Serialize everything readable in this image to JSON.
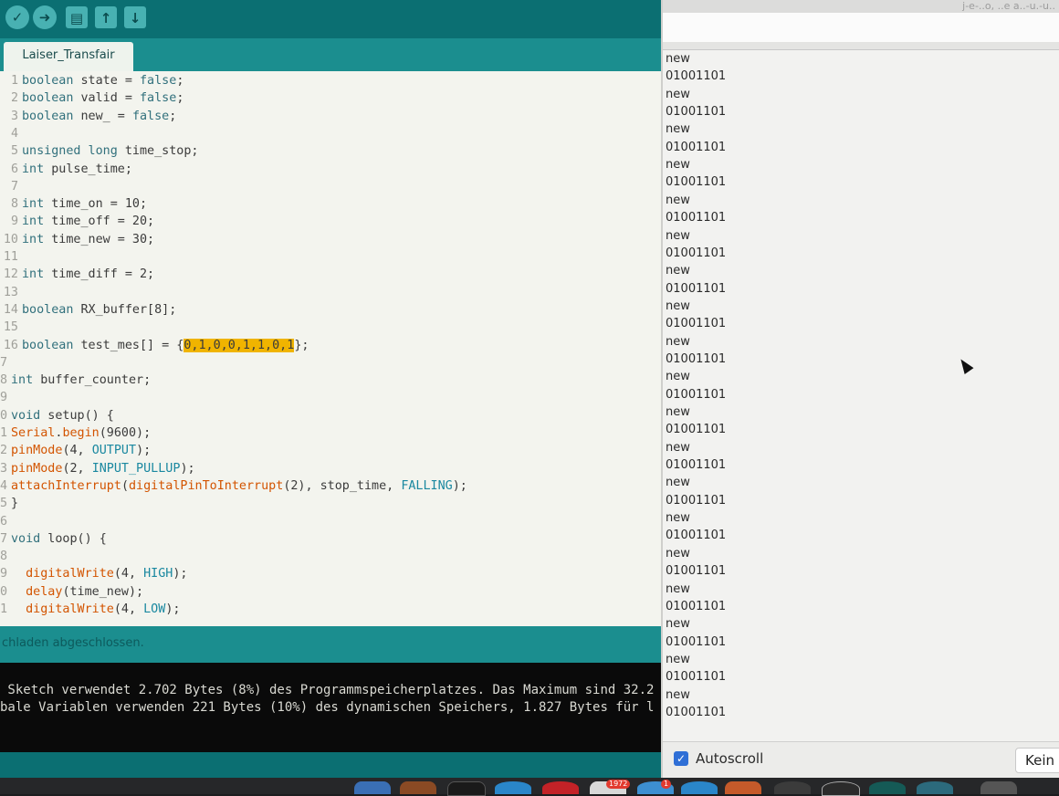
{
  "ide": {
    "tab_name": "Laiser_Transfair",
    "code_lines": [
      {
        "n": "1",
        "parts": [
          {
            "t": "boolean",
            "c": "ty"
          },
          {
            "t": " state = "
          },
          {
            "t": "false",
            "c": "kw"
          },
          {
            "t": ";"
          }
        ]
      },
      {
        "n": "2",
        "parts": [
          {
            "t": "boolean",
            "c": "ty"
          },
          {
            "t": " valid = "
          },
          {
            "t": "false",
            "c": "kw"
          },
          {
            "t": ";"
          }
        ]
      },
      {
        "n": "3",
        "parts": [
          {
            "t": "boolean",
            "c": "ty"
          },
          {
            "t": " new_ = "
          },
          {
            "t": "false",
            "c": "kw"
          },
          {
            "t": ";"
          }
        ]
      },
      {
        "n": "4",
        "parts": []
      },
      {
        "n": "5",
        "parts": [
          {
            "t": "unsigned long",
            "c": "ty"
          },
          {
            "t": " time_stop;"
          }
        ]
      },
      {
        "n": "6",
        "parts": [
          {
            "t": "int",
            "c": "ty"
          },
          {
            "t": " pulse_time;"
          }
        ]
      },
      {
        "n": "7",
        "parts": []
      },
      {
        "n": "8",
        "parts": [
          {
            "t": "int",
            "c": "ty"
          },
          {
            "t": " time_on = 10;"
          }
        ]
      },
      {
        "n": "9",
        "parts": [
          {
            "t": "int",
            "c": "ty"
          },
          {
            "t": " time_off = 20;"
          }
        ]
      },
      {
        "n": "10",
        "parts": [
          {
            "t": "int",
            "c": "ty"
          },
          {
            "t": " time_new = 30;"
          }
        ]
      },
      {
        "n": "11",
        "parts": []
      },
      {
        "n": "12",
        "parts": [
          {
            "t": "int",
            "c": "ty"
          },
          {
            "t": " time_diff = 2;"
          }
        ]
      },
      {
        "n": "13",
        "parts": []
      },
      {
        "n": "14",
        "parts": [
          {
            "t": "boolean",
            "c": "ty"
          },
          {
            "t": " RX_buffer[8];"
          }
        ]
      },
      {
        "n": "15",
        "parts": []
      },
      {
        "n": "16",
        "parts": [
          {
            "t": "boolean",
            "c": "ty"
          },
          {
            "t": " test_mes[] = {"
          },
          {
            "t": "0,1,0,0,1,1,0,1",
            "c": "hl"
          },
          {
            "t": "};"
          }
        ]
      },
      {
        "n": "7",
        "cut": true,
        "parts": []
      },
      {
        "n": "8",
        "cut": true,
        "parts": [
          {
            "t": "int",
            "c": "ty"
          },
          {
            "t": " buffer_counter;"
          }
        ]
      },
      {
        "n": "9",
        "cut": true,
        "parts": []
      },
      {
        "n": "0",
        "cut": true,
        "parts": [
          {
            "t": "void",
            "c": "ty"
          },
          {
            "t": " setup() {"
          }
        ]
      },
      {
        "n": "1",
        "cut": true,
        "parts": [
          {
            "t": "Serial",
            "c": "fn"
          },
          {
            "t": "."
          },
          {
            "t": "begin",
            "c": "fn"
          },
          {
            "t": "(9600);"
          }
        ]
      },
      {
        "n": "2",
        "cut": true,
        "parts": [
          {
            "t": "pinMode",
            "c": "fn"
          },
          {
            "t": "(4, "
          },
          {
            "t": "OUTPUT",
            "c": "cn"
          },
          {
            "t": ");"
          }
        ]
      },
      {
        "n": "3",
        "cut": true,
        "parts": [
          {
            "t": "pinMode",
            "c": "fn"
          },
          {
            "t": "(2, "
          },
          {
            "t": "INPUT_PULLUP",
            "c": "cn"
          },
          {
            "t": ");"
          }
        ]
      },
      {
        "n": "4",
        "cut": true,
        "parts": [
          {
            "t": "attachInterrupt",
            "c": "fn"
          },
          {
            "t": "("
          },
          {
            "t": "digitalPinToInterrupt",
            "c": "fn"
          },
          {
            "t": "(2), stop_time, "
          },
          {
            "t": "FALLING",
            "c": "cn"
          },
          {
            "t": ");"
          }
        ]
      },
      {
        "n": "5",
        "cut": true,
        "parts": [
          {
            "t": "}"
          }
        ]
      },
      {
        "n": "6",
        "cut": true,
        "parts": []
      },
      {
        "n": "7",
        "cut": true,
        "parts": [
          {
            "t": "void",
            "c": "ty"
          },
          {
            "t": " loop() {"
          }
        ]
      },
      {
        "n": "8",
        "cut": true,
        "parts": []
      },
      {
        "n": "9",
        "cut": true,
        "parts": [
          {
            "t": "  "
          },
          {
            "t": "digitalWrite",
            "c": "fn"
          },
          {
            "t": "(4, "
          },
          {
            "t": "HIGH",
            "c": "cn"
          },
          {
            "t": ");"
          }
        ]
      },
      {
        "n": "0",
        "cut": true,
        "parts": [
          {
            "t": "  "
          },
          {
            "t": "delay",
            "c": "fn"
          },
          {
            "t": "(time_new);"
          }
        ]
      },
      {
        "n": "1",
        "cut": true,
        "parts": [
          {
            "t": "  "
          },
          {
            "t": "digitalWrite",
            "c": "fn"
          },
          {
            "t": "(4, "
          },
          {
            "t": "LOW",
            "c": "cn"
          },
          {
            "t": ");"
          }
        ]
      }
    ],
    "status_message": "chladen abgeschlossen.",
    "console_lines": [
      " Sketch verwendet 2.702 Bytes (8%) des Programmspeicherplatzes. Das Maximum sind 32.2",
      "bale Variablen verwenden 221 Bytes (10%) des dynamischen Speichers, 1.827 Bytes für l"
    ]
  },
  "serial_monitor": {
    "title_fragment": "j-e-..o, ..e a..-u.-u..",
    "output_lines": [
      "new",
      "01001101",
      "new",
      "01001101",
      "new",
      "01001101",
      "new",
      "01001101",
      "new",
      "01001101",
      "new",
      "01001101",
      "new",
      "01001101",
      "new",
      "01001101",
      "new",
      "01001101",
      "new",
      "01001101",
      "new",
      "01001101",
      "new",
      "01001101",
      "new",
      "01001101",
      "new",
      "01001101",
      "new",
      "01001101",
      "new",
      "01001101",
      "new",
      "01001101",
      "new",
      "01001101",
      "new",
      "01001101"
    ],
    "autoscroll_label": "Autoscroll",
    "autoscroll_checked": true,
    "line_ending": "Kein"
  },
  "dock": {
    "badges": [
      "1972",
      "1"
    ]
  },
  "colors": {
    "teal_dark": "#0b6f72",
    "teal": "#1b8e8f",
    "editor_bg": "#f3f4ee",
    "highlight": "#f0b400",
    "function": "#d35400",
    "keyword": "#31707c"
  },
  "icons": [
    "verify-icon",
    "upload-icon",
    "new-sketch-icon",
    "open-icon",
    "save-icon",
    "autoscroll-checkbox-icon"
  ]
}
